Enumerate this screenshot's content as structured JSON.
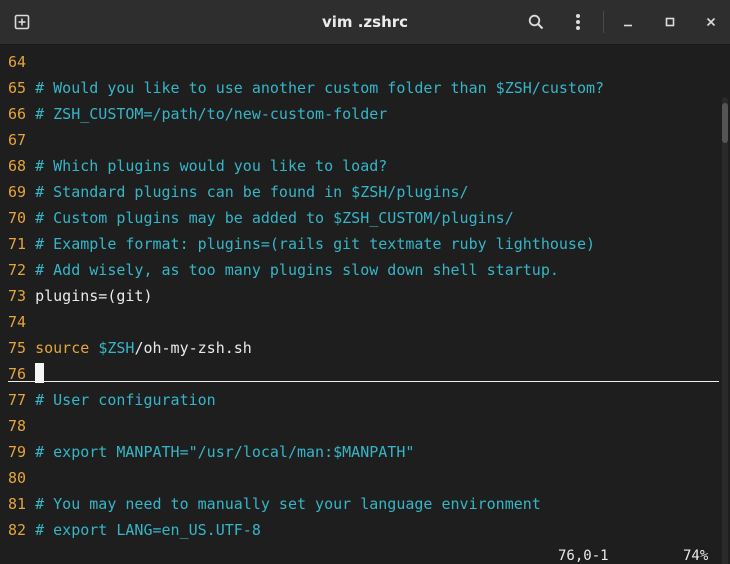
{
  "window": {
    "title": "vim .zshrc"
  },
  "titlebar": {
    "buttons": {
      "new_tab": "new-tab-icon",
      "search": "search-icon",
      "menu": "kebab-menu-icon",
      "minimize": "minimize-icon",
      "maximize": "maximize-icon",
      "close": "close-icon"
    }
  },
  "editor": {
    "lines": [
      {
        "num": "64",
        "code": ""
      },
      {
        "num": "65",
        "code": "# Would you like to use another custom folder than $ZSH/custom?"
      },
      {
        "num": "66",
        "code": "# ZSH_CUSTOM=/path/to/new-custom-folder"
      },
      {
        "num": "67",
        "code": ""
      },
      {
        "num": "68",
        "code": "# Which plugins would you like to load?"
      },
      {
        "num": "69",
        "code": "# Standard plugins can be found in $ZSH/plugins/"
      },
      {
        "num": "70",
        "code": "# Custom plugins may be added to $ZSH_CUSTOM/plugins/"
      },
      {
        "num": "71",
        "code": "# Example format: plugins=(rails git textmate ruby lighthouse)"
      },
      {
        "num": "72",
        "code": "# Add wisely, as too many plugins slow down shell startup."
      },
      {
        "num": "73",
        "code": "plugins=(git)"
      },
      {
        "num": "74",
        "code": ""
      },
      {
        "num": "75",
        "keyword": "source",
        "space": " ",
        "variable": "$ZSH",
        "rest": "/oh-my-zsh.sh"
      },
      {
        "num": "76",
        "code": ""
      },
      {
        "num": "77",
        "code": "# User configuration"
      },
      {
        "num": "78",
        "code": ""
      },
      {
        "num": "79",
        "code": "# export MANPATH=\"/usr/local/man:$MANPATH\""
      },
      {
        "num": "80",
        "code": ""
      },
      {
        "num": "81",
        "code": "# You may need to manually set your language environment"
      },
      {
        "num": "82",
        "code": "# export LANG=en_US.UTF-8"
      }
    ]
  },
  "status": {
    "position": "76,0-1",
    "percent": "74%"
  },
  "colors": {
    "background": "#1e1e1e",
    "line_number": "#e5a53a",
    "comment": "#35b6c8",
    "text": "#eaeaea",
    "keyword": "#e5a53a",
    "variable": "#35b6c8"
  }
}
